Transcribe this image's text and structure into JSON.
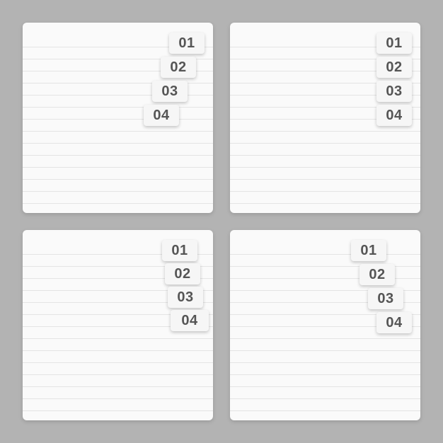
{
  "notepads": [
    {
      "variant": "a",
      "tabs": [
        "01",
        "02",
        "03",
        "04"
      ]
    },
    {
      "variant": "b",
      "tabs": [
        "01",
        "02",
        "03",
        "04"
      ]
    },
    {
      "variant": "c",
      "tabs": [
        "01",
        "02",
        "03",
        "04"
      ]
    },
    {
      "variant": "d",
      "tabs": [
        "01",
        "02",
        "03",
        "04"
      ]
    }
  ]
}
